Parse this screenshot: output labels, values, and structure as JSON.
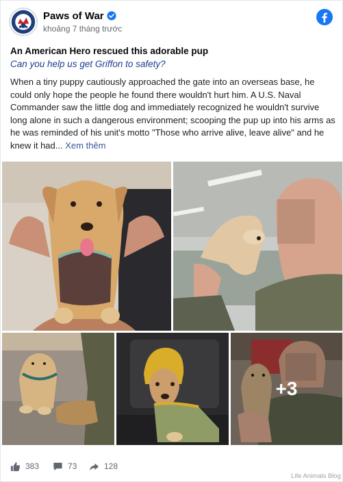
{
  "post": {
    "page_name": "Paws of War",
    "timestamp": "khoảng 7 tháng trước",
    "title": "An American Hero rescued this adorable pup",
    "subtitle": "Can you help us get Griffon to safety?",
    "body_text": "When a tiny puppy cautiously approached the gate into an overseas base, he could only hope the people he found there wouldn't hurt him. A U.S. Naval Commander saw the little dog and immediately recognized he wouldn't survive long alone in such a dangerous environment; scooping the pup up into his arms as he was reminded of his unit's motto \"Those who arrive alive, leave alive\" and he knew it had...",
    "see_more": "Xem thêm"
  },
  "photos": {
    "more_count": "+3"
  },
  "footer": {
    "likes": "383",
    "comments": "73",
    "shares": "128"
  },
  "watermark": "Life Animals Blog",
  "colors": {
    "facebook_blue": "#1877f2",
    "link_blue": "#385898",
    "subtitle_blue": "#1d3d8f"
  }
}
